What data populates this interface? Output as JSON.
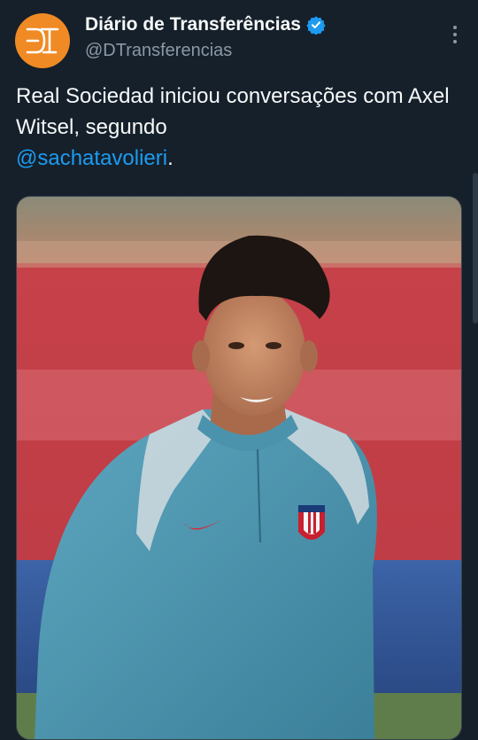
{
  "author": {
    "display_name": "Diário de Transferências",
    "handle": "@DTransferencias",
    "avatar_initials": "DT",
    "avatar_color": "#f08a24",
    "verified": true
  },
  "tweet": {
    "text_before": "Real Sociedad iniciou conversações com Axel Witsel, segundo",
    "mention": "@sachatavolieri",
    "text_after": "."
  },
  "colors": {
    "background": "#15202b",
    "text": "#f7f9f9",
    "muted": "#8b98a5",
    "link": "#1d9bf0",
    "verified": "#1d9bf0"
  },
  "icons": {
    "verified": "verified-badge-icon",
    "more": "more-options-icon"
  }
}
